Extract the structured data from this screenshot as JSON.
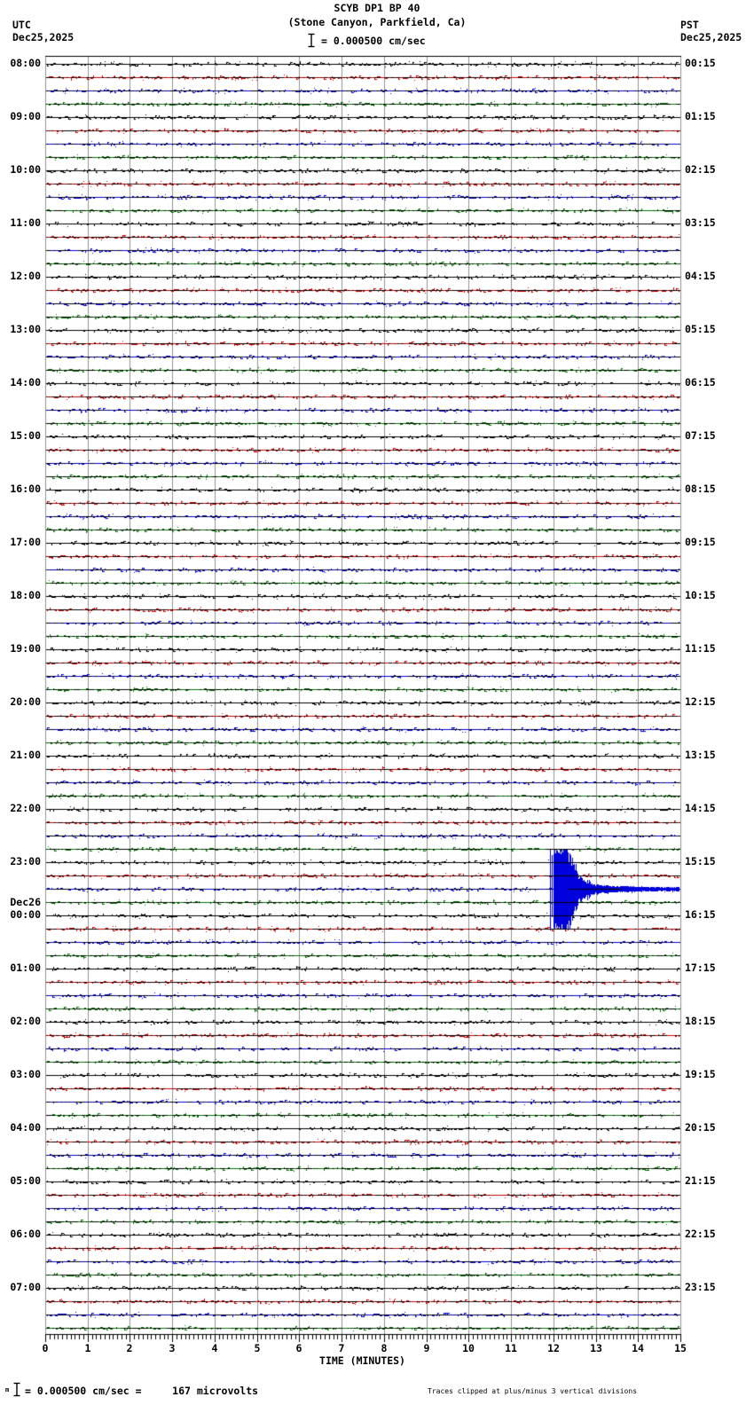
{
  "title": {
    "line1": "SCYB DP1 BP 40",
    "line2": "(Stone Canyon, Parkfield, Ca)"
  },
  "scale_note": {
    "icon": "scale-bar-icon",
    "text": "= 0.000500 cm/sec"
  },
  "header_left": {
    "timezone": "UTC",
    "date": "Dec25,2025"
  },
  "header_right": {
    "timezone": "PST",
    "date": "Dec25,2025"
  },
  "footer": {
    "left_prefix": "m",
    "left_icon": "scale-bar-icon",
    "left_text": "= 0.000500 cm/sec =     167 microvolts",
    "right_text": "Traces clipped at plus/minus 3 vertical divisions"
  },
  "chart_data": {
    "type": "line",
    "subtype": "helicorder-seismogram",
    "title": "SCYB DP1 BP 40 (Stone Canyon, Parkfield, Ca)",
    "xlabel": "TIME (MINUTES)",
    "x_range": [
      0,
      15
    ],
    "x_tick_labels": [
      "0",
      "1",
      "2",
      "3",
      "4",
      "5",
      "6",
      "7",
      "8",
      "9",
      "10",
      "11",
      "12",
      "13",
      "14",
      "15"
    ],
    "minor_ticks_per_minute": 10,
    "minutes_per_line": 15,
    "traces_per_hour": 4,
    "total_traces": 96,
    "start_time_utc": "08:00 Dec25,2025",
    "end_time_utc": "08:00 Dec26,2025",
    "trace_color_cycle": [
      "#000000",
      "#cc0000",
      "#0000dd",
      "#007700"
    ],
    "grid_color": "#909090",
    "background_color": "#ffffff",
    "noise_amplitude_divisions": 0.15,
    "clip_divisions": 3,
    "left_axis_labels": [
      {
        "main": "08:00"
      },
      {
        "main": "09:00"
      },
      {
        "main": "10:00"
      },
      {
        "main": "11:00"
      },
      {
        "main": "12:00"
      },
      {
        "main": "13:00"
      },
      {
        "main": "14:00"
      },
      {
        "main": "15:00"
      },
      {
        "main": "16:00"
      },
      {
        "main": "17:00"
      },
      {
        "main": "18:00"
      },
      {
        "main": "19:00"
      },
      {
        "main": "20:00"
      },
      {
        "main": "21:00"
      },
      {
        "main": "22:00"
      },
      {
        "main": "23:00"
      },
      {
        "pre": "Dec26",
        "main": "00:00"
      },
      {
        "main": "01:00"
      },
      {
        "main": "02:00"
      },
      {
        "main": "03:00"
      },
      {
        "main": "04:00"
      },
      {
        "main": "05:00"
      },
      {
        "main": "06:00"
      },
      {
        "main": "07:00"
      }
    ],
    "right_axis_labels": [
      "00:15",
      "01:15",
      "02:15",
      "03:15",
      "04:15",
      "05:15",
      "06:15",
      "07:15",
      "08:15",
      "09:15",
      "10:15",
      "11:15",
      "12:15",
      "13:15",
      "14:15",
      "15:15",
      "16:15",
      "17:15",
      "18:15",
      "19:15",
      "20:15",
      "21:15",
      "22:15",
      "23:15"
    ],
    "event": {
      "description": "Single clipped earthquake signature with decaying coda",
      "trace_utc_start": "23:30",
      "trace_date": "Dec25,2025",
      "trace_row_index": 62,
      "color": "#0000dd",
      "onset_minute": 11.9,
      "peak_minute": 12.1,
      "coda_end_minute": 13.5,
      "clipped": true,
      "clip_divisions": 3,
      "approx_time_utc": "23:42"
    }
  }
}
